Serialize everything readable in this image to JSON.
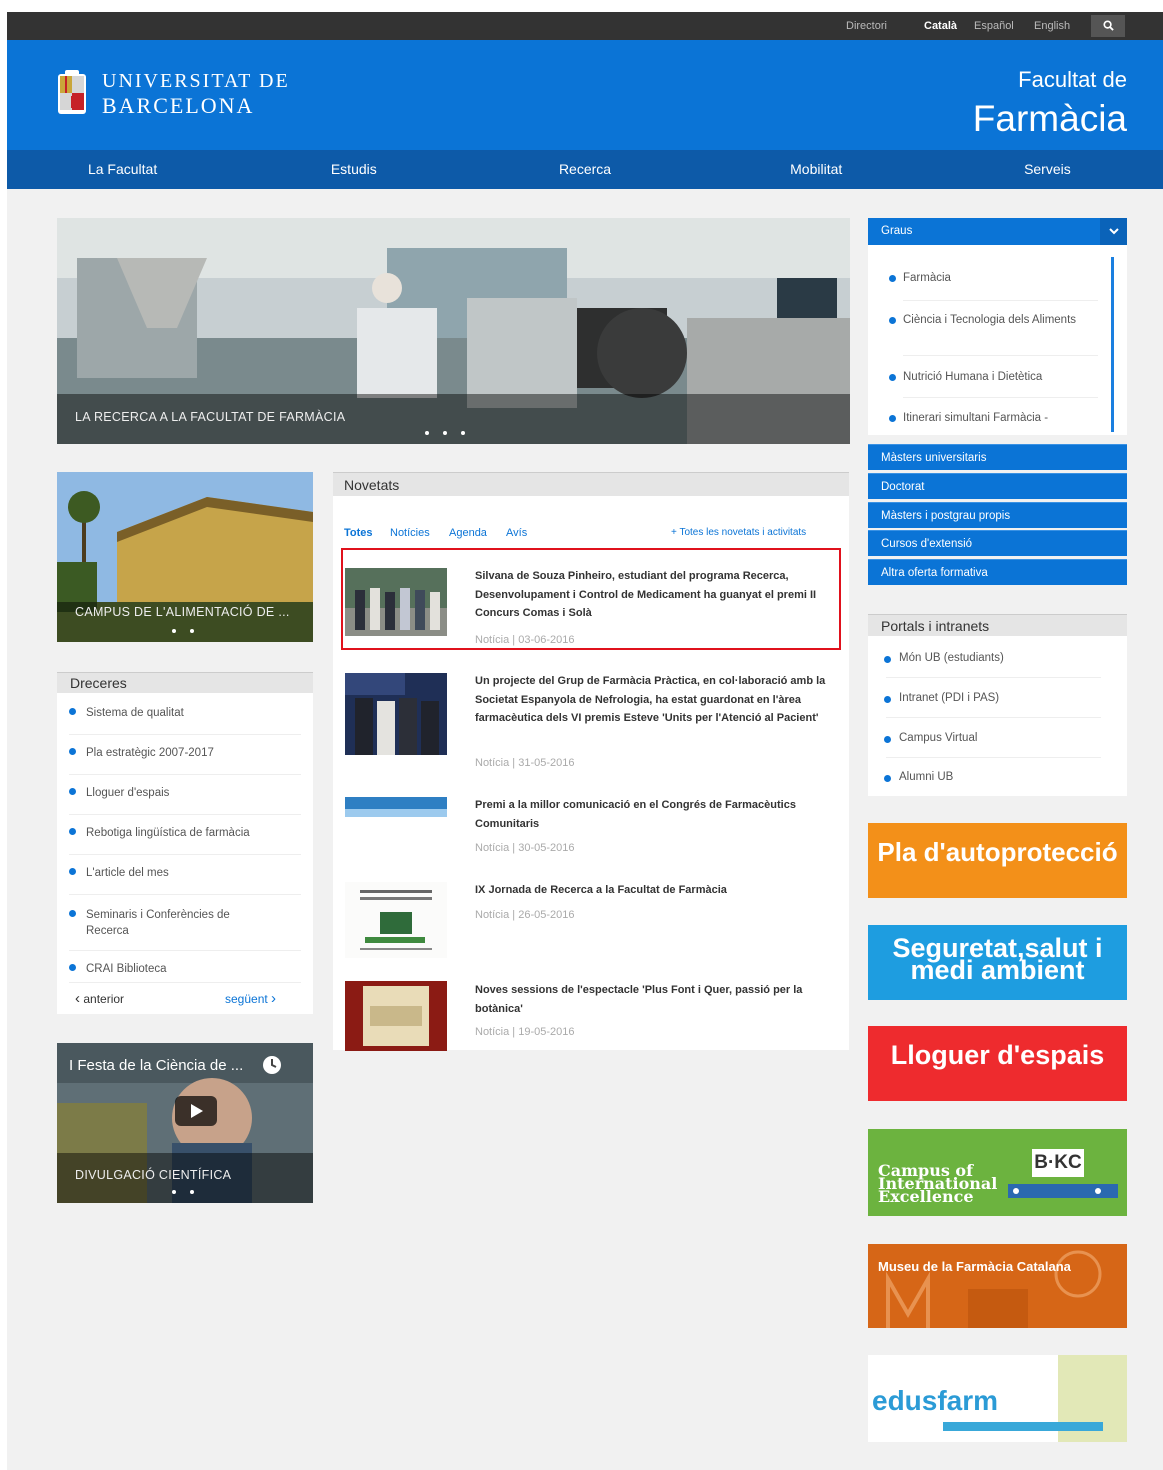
{
  "topbar": {
    "links": [
      "Directori",
      "Català",
      "Español",
      "English"
    ],
    "active_language": "Català",
    "search_icon": "search-icon"
  },
  "header": {
    "university_line1": "UNIVERSITAT DE",
    "university_line2": "BARCELONA",
    "faculty_sub": "Facultat de",
    "faculty_name": "Farmàcia"
  },
  "nav": [
    "La Facultat",
    "Estudis",
    "Recerca",
    "Mobilitat",
    "Serveis"
  ],
  "hero": {
    "caption": "LA RECERCA A LA FACULTAT DE FARMÀCIA"
  },
  "campus": {
    "caption": "CAMPUS DE L'ALIMENTACIÓ DE ..."
  },
  "dreceres": {
    "title": "Dreceres",
    "items": [
      "Sistema de qualitat",
      "Pla estratègic 2007-2017",
      "Lloguer d'espais",
      "Rebotiga lingüística de farmàcia",
      "L'article del mes",
      "Seminaris i Conferències de Recerca",
      "CRAI Biblioteca"
    ],
    "prev": "anterior",
    "next": "següent"
  },
  "video": {
    "title": "I Festa de la Ciència de ...",
    "caption": "DIVULGACIÓ CIENTÍFICA"
  },
  "novetats": {
    "title": "Novetats",
    "tabs": [
      "Totes",
      "Notícies",
      "Agenda",
      "Avís"
    ],
    "all_link": "+ Totes les novetats i activitats",
    "items": [
      {
        "title": "Silvana de Souza Pinheiro, estudiant del programa Recerca, Desenvolupament i Control de Medicament ha guanyat el premi II Concurs Comas i Solà",
        "date": "Notícia | 03-06-2016"
      },
      {
        "title": "Un projecte del Grup de Farmàcia Pràctica, en col·laboració amb la Societat Espanyola de Nefrologia, ha estat guardonat en l'àrea farmacèutica dels VI premis Esteve 'Units per l'Atenció al Pacient'",
        "date": "Notícia | 31-05-2016"
      },
      {
        "title": "Premi a la millor comunicació en el Congrés de Farmacèutics Comunitaris",
        "date": "Notícia | 30-05-2016"
      },
      {
        "title": "IX Jornada de Recerca a la Facultat de Farmàcia",
        "date": "Notícia | 26-05-2016"
      },
      {
        "title": "Noves sessions de l'espectacle 'Plus Font i Quer, passió per la botànica'",
        "date": "Notícia | 19-05-2016"
      }
    ]
  },
  "graus": {
    "header": "Graus",
    "items": [
      "Farmàcia",
      "Ciència i Tecnologia dels Aliments",
      "Nutrició Humana i Dietètica",
      "Itinerari simultani Farmàcia -"
    ],
    "bars": [
      "Màsters universitaris",
      "Doctorat",
      "Màsters i postgrau propis",
      "Cursos d'extensió",
      "Altra oferta formativa"
    ]
  },
  "portals": {
    "title": "Portals i intranets",
    "items": [
      "Món UB (estudiants)",
      "Intranet (PDI i PAS)",
      "Campus Virtual",
      "Alumni UB"
    ]
  },
  "banners": {
    "autoproteccio": "Pla d'autoprotecció",
    "seguretat_line1": "Seguretat,salut i",
    "seguretat_line2": "medi ambient",
    "lloguer": "Lloguer d'espais",
    "campus_line1": "Campus of",
    "campus_line2": "International",
    "campus_line3": "Excellence",
    "bkc": "B·KC",
    "museu": "Museu de la Farmàcia Catalana",
    "edusfarm": "edusfarm"
  }
}
